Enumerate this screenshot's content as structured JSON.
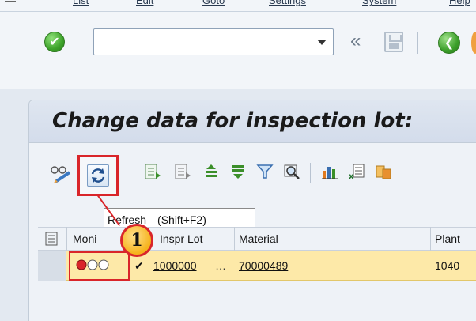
{
  "menu": {
    "items": [
      "List",
      "Edit",
      "Goto",
      "Settings",
      "System",
      "Help"
    ]
  },
  "system_toolbar": {
    "command_field_value": "",
    "back_glyph": "«"
  },
  "title": "Change data for inspection lot:",
  "tooltip": {
    "label": "Refresh",
    "shortcut": "(Shift+F2)"
  },
  "callout": {
    "number": "1"
  },
  "table": {
    "columns": [
      "Moni",
      "Inspr Lot",
      "Material",
      "Plant"
    ],
    "rows": [
      {
        "monitor": "red-light",
        "check": "✔",
        "inspection_lot": "1000000",
        "material": "70000489",
        "plant": "1040"
      }
    ]
  },
  "colors": {
    "highlight": "#d9252a",
    "selected_row": "#fde9a8",
    "panel_bg": "#eef2f7"
  }
}
